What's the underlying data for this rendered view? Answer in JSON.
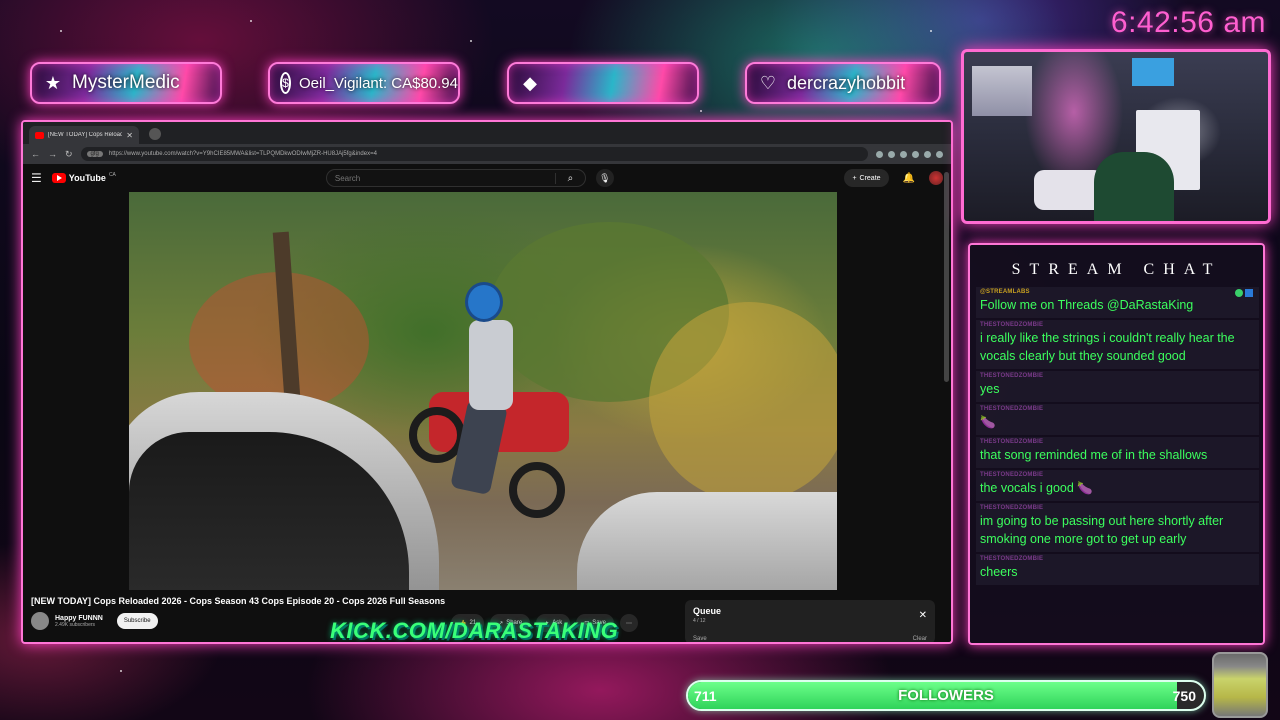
{
  "clock": "6:42:56 am",
  "alerts": [
    {
      "icon": "star-icon",
      "text": "MysterMedic"
    },
    {
      "icon": "dollar-icon",
      "text": "Oeil_Vigilant: CA$80.94"
    },
    {
      "icon": "diamond-icon",
      "text": ""
    },
    {
      "icon": "heart-icon",
      "text": "dercrazyhobbit"
    }
  ],
  "browser": {
    "tab_title": "[NEW TODAY] Cops Reload",
    "url": "https://www.youtube.com/watch?v=Y9hCIE85MWA&list=TLPQMDkwODIwMjZR-HU8JAj5fg&index=4",
    "url_tag": "gfg"
  },
  "youtube": {
    "logo": "YouTube",
    "region": "CA",
    "search_placeholder": "Search",
    "create_label": "Create",
    "video_title": "[NEW TODAY] Cops Reloaded 2026 - Cops Season 43 Cops Episode 20 - Cops 2026 Full Seasons",
    "channel_name": "Happy FUNNN",
    "subscribers": "2.49K subscribers",
    "subscribe_label": "Subscribe",
    "like_count": "21",
    "share_label": "Share",
    "ask_label": "Ask",
    "save_label": "Save",
    "queue": {
      "title": "Queue",
      "position": "4 / 12",
      "save": "Save",
      "clear": "Clear"
    }
  },
  "kick_overlay": "KICK.COM/DARASTAKING",
  "chat": {
    "title": "STREAM CHAT",
    "messages": [
      {
        "user": "@STREAMLABS",
        "text": "Follow me on Threads @DaRastaKing"
      },
      {
        "user": "THESTONEDZOMBIE",
        "text": "i really like the strings i couldn't really hear the vocals clearly but they sounded good"
      },
      {
        "user": "THESTONEDZOMBIE",
        "text": "yes"
      },
      {
        "user": "THESTONEDZOMBIE",
        "text": "🍆"
      },
      {
        "user": "THESTONEDZOMBIE",
        "text": "that song reminded me of in the shallows"
      },
      {
        "user": "THESTONEDZOMBIE",
        "text": "the vocals i good 🍆"
      },
      {
        "user": "THESTONEDZOMBIE",
        "text": "im going to be passing out here shortly after smoking one more got to get up early"
      },
      {
        "user": "THESTONEDZOMBIE",
        "text": "cheers"
      }
    ]
  },
  "followers": {
    "label": "FOLLOWERS",
    "current": "711",
    "goal": "750",
    "progress": 0.948
  },
  "colors": {
    "accent": "#ff76d6",
    "chat_text": "#3cff5e",
    "kick": "#39ff79",
    "clock": "#ff5fd0"
  }
}
